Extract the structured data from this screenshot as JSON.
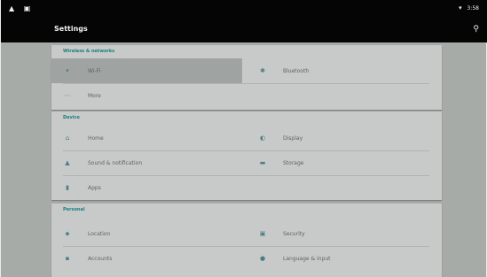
{
  "status_bar": {
    "left_icons": "▲ ▣",
    "wifi_icon": "wifi-icon",
    "time": "3:58"
  },
  "app_bar": {
    "title": "Settings",
    "search_icon": "search-icon"
  },
  "sections": [
    {
      "header": "Wireless & networks",
      "items": [
        {
          "label": "Wi-Fi",
          "icon": "wifi-icon",
          "glyph": "▾"
        },
        {
          "label": "Bluetooth",
          "icon": "bluetooth-icon",
          "glyph": "✱"
        },
        {
          "label": "More",
          "icon": "more-icon",
          "glyph": "⋯"
        }
      ]
    },
    {
      "header": "Device",
      "items": [
        {
          "label": "Home",
          "icon": "home-icon",
          "glyph": "⌂"
        },
        {
          "label": "Display",
          "icon": "display-icon",
          "glyph": "◐"
        },
        {
          "label": "Sound & notification",
          "icon": "bell-icon",
          "glyph": "▲"
        },
        {
          "label": "Storage",
          "icon": "storage-icon",
          "glyph": "▬"
        },
        {
          "label": "Apps",
          "icon": "android-icon",
          "glyph": "▮"
        }
      ]
    },
    {
      "header": "Personal",
      "items": [
        {
          "label": "Location",
          "icon": "location-icon",
          "glyph": "⬥"
        },
        {
          "label": "Security",
          "icon": "lock-icon",
          "glyph": "▣"
        },
        {
          "label": "Accounts",
          "icon": "account-icon",
          "glyph": "▪"
        },
        {
          "label": "Language & input",
          "icon": "globe-icon",
          "glyph": "●"
        }
      ]
    }
  ],
  "colors": {
    "status_bar": "#050505",
    "content_bg": "#a7aba8",
    "card_bg": "#c7cac8",
    "header_accent": "#1b7e80",
    "selected_row": "#9fa3a1"
  }
}
